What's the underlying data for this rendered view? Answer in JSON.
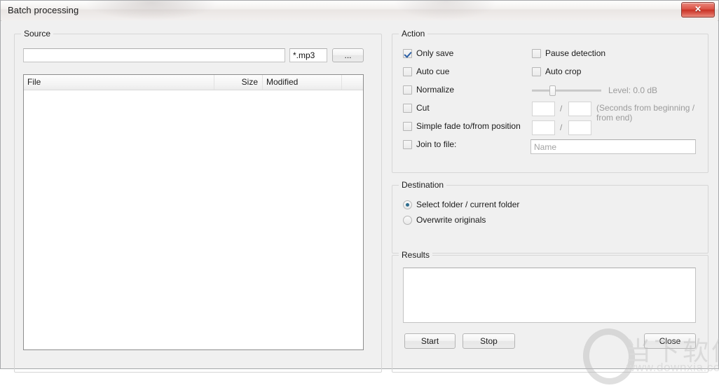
{
  "window": {
    "title": "Batch processing",
    "close_label": "✕"
  },
  "source": {
    "legend": "Source",
    "path_value": "",
    "path_placeholder": "",
    "filter_value": "*.mp3",
    "browse_label": "...",
    "columns": [
      "File",
      "Size",
      "Modified"
    ],
    "rows": []
  },
  "action": {
    "legend": "Action",
    "left_options": [
      {
        "label": "Only save",
        "checked": true
      },
      {
        "label": "Auto cue",
        "checked": false
      },
      {
        "label": "Normalize",
        "checked": false
      },
      {
        "label": "Cut",
        "checked": false
      },
      {
        "label": "Simple fade to/from position",
        "checked": false
      },
      {
        "label": "Join to file:",
        "checked": false
      }
    ],
    "right_options": [
      {
        "label": "Pause detection",
        "checked": false
      },
      {
        "label": "Auto crop",
        "checked": false
      }
    ],
    "level_label": "Level: 0.0 dB",
    "level_percent": 28,
    "cut_begin": "",
    "cut_end": "",
    "fade_begin": "",
    "fade_end": "",
    "separator": "/",
    "seconds_hint_line1": "(Seconds from beginning /",
    "seconds_hint_line2": "from end)",
    "join_name_placeholder": "Name",
    "join_name_value": ""
  },
  "destination": {
    "legend": "Destination",
    "options": [
      {
        "label": "Select folder / current folder",
        "checked": true
      },
      {
        "label": "Overwrite originals",
        "checked": false
      }
    ]
  },
  "results": {
    "legend": "Results",
    "log_value": "",
    "start_label": "Start",
    "stop_label": "Stop",
    "close_label": "Close"
  },
  "watermark": {
    "chinese": "当下软件园",
    "url": "www.downxia.com"
  }
}
